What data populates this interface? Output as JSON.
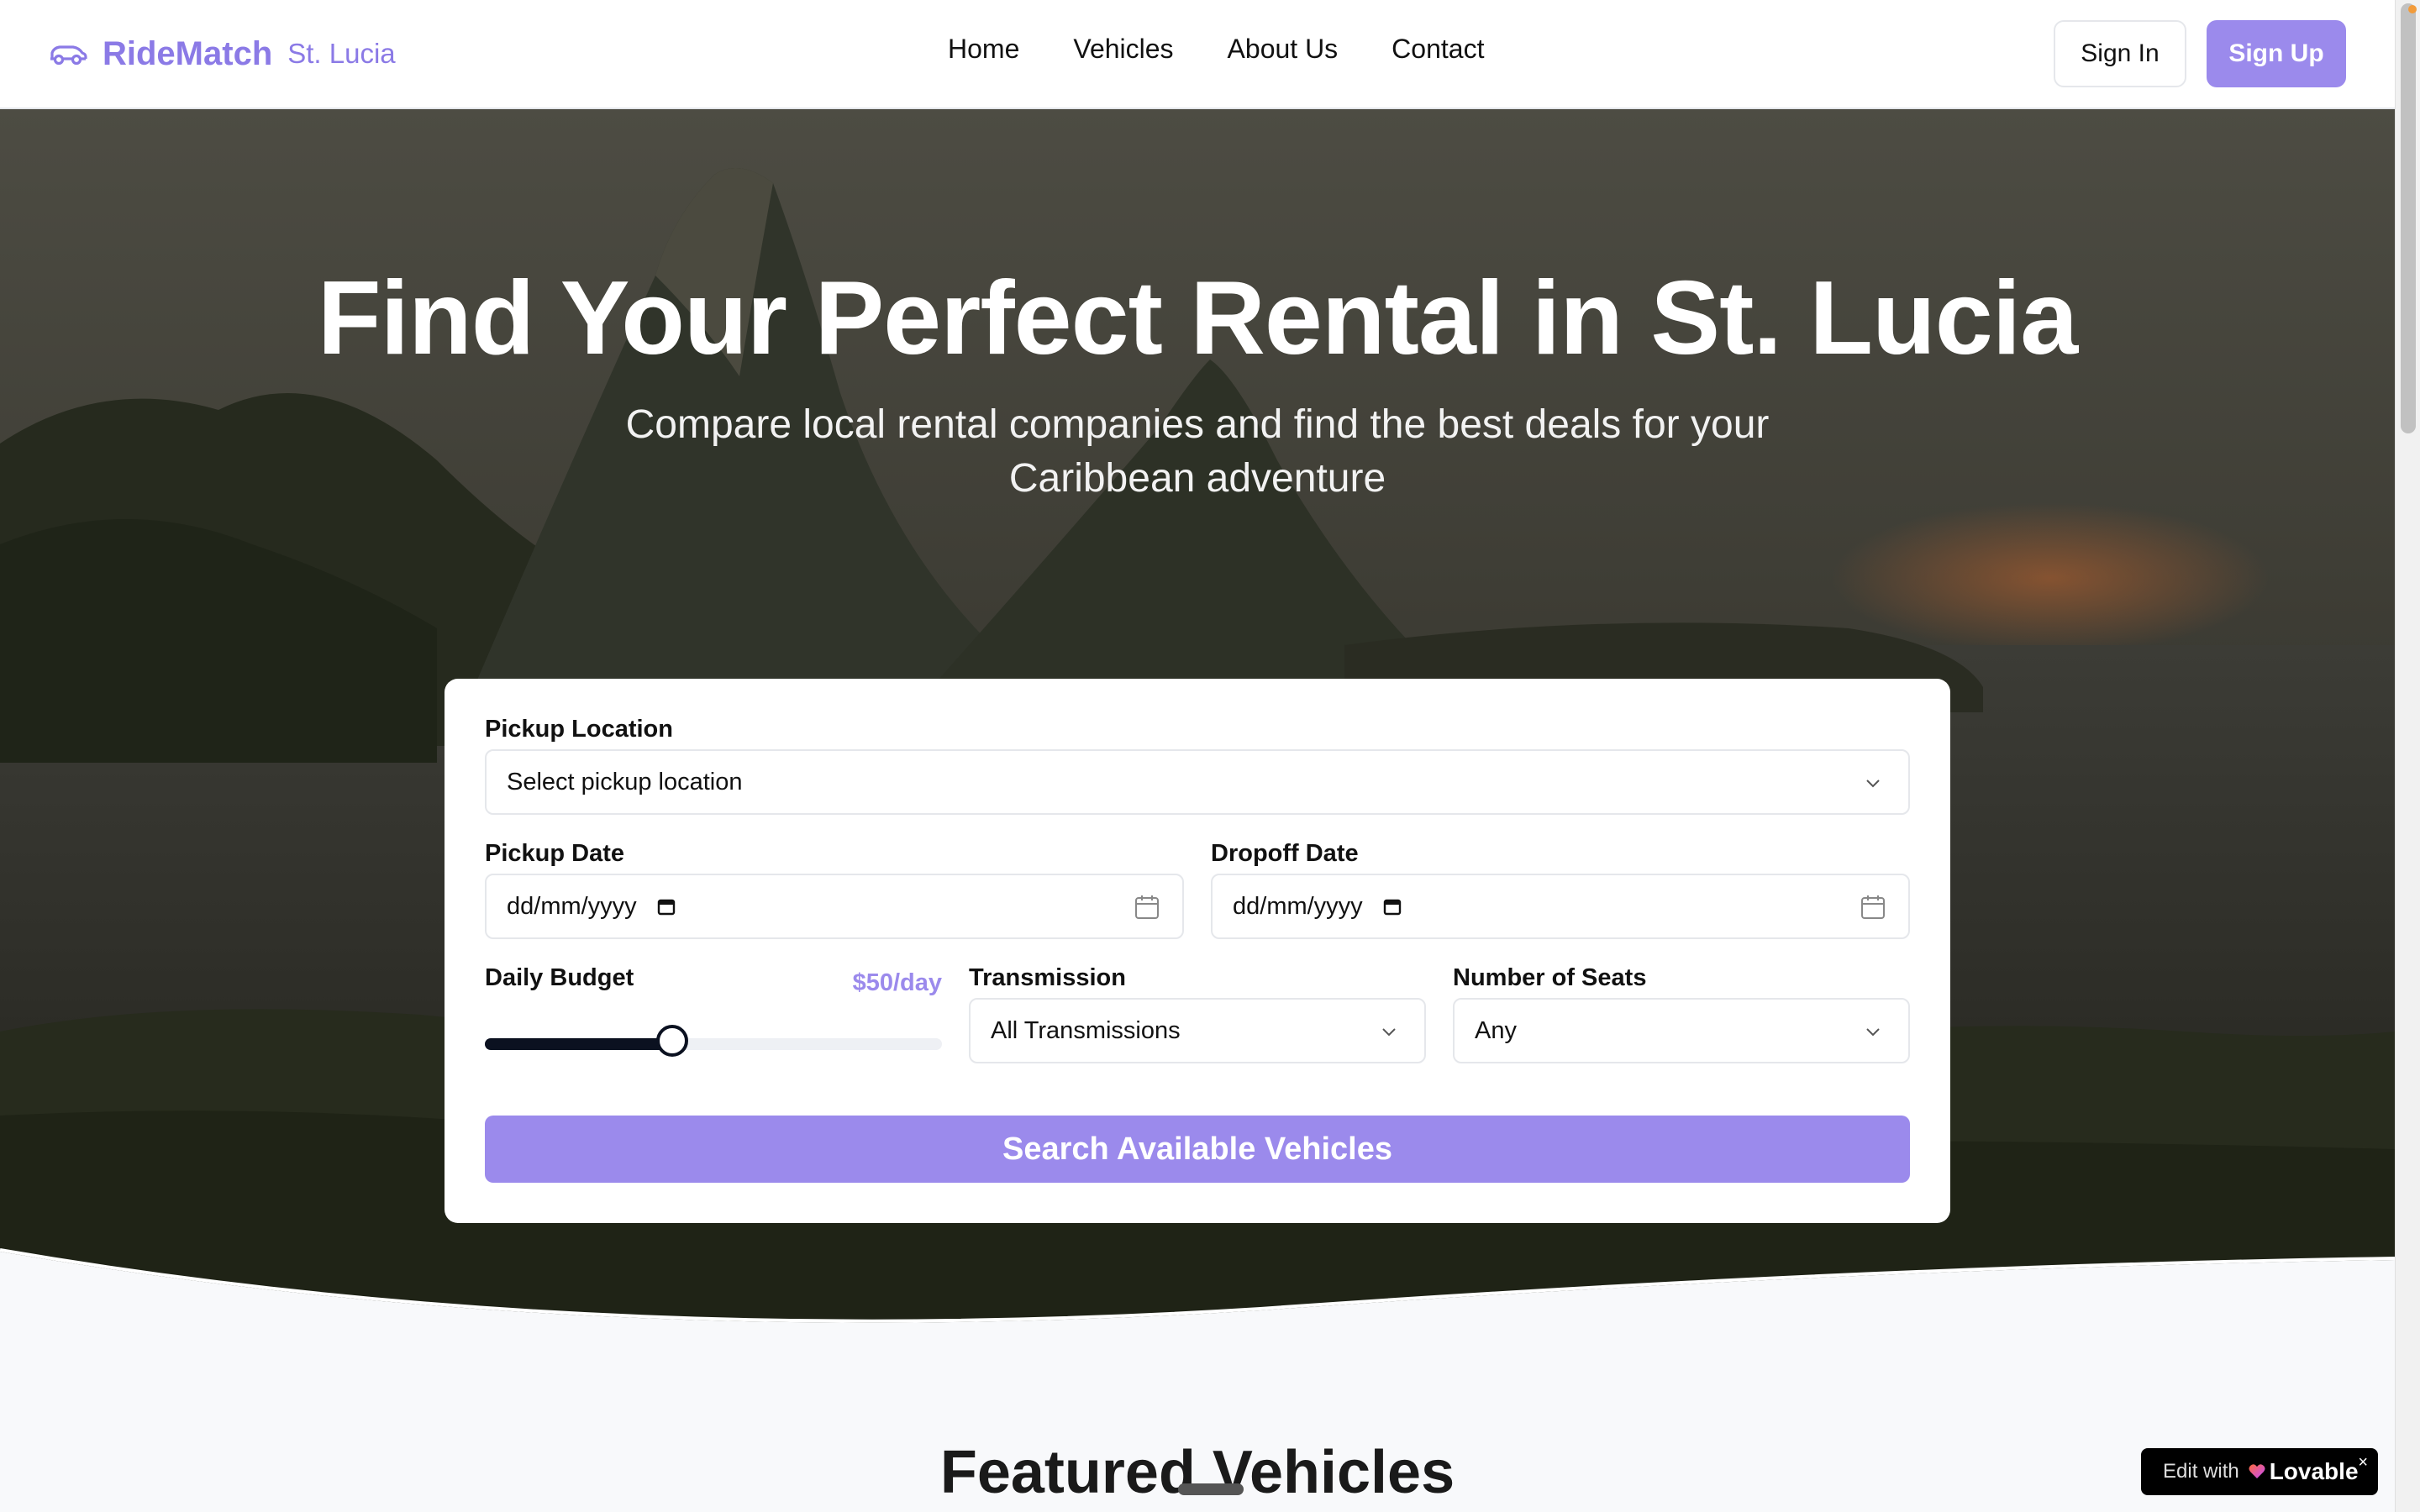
{
  "header": {
    "brand_name": "RideMatch",
    "brand_location": "St. Lucia",
    "nav": [
      "Home",
      "Vehicles",
      "About Us",
      "Contact"
    ],
    "sign_in": "Sign In",
    "sign_up": "Sign Up"
  },
  "hero": {
    "title": "Find Your Perfect Rental in St. Lucia",
    "subtitle": "Compare local rental companies and find the best deals for your Caribbean adventure"
  },
  "search": {
    "pickup_location_label": "Pickup Location",
    "pickup_location_value": "Select pickup location",
    "pickup_date_label": "Pickup Date",
    "pickup_date_value": "dd/mm/yyyy",
    "dropoff_date_label": "Dropoff Date",
    "dropoff_date_value": "dd/mm/yyyy",
    "budget_label": "Daily Budget",
    "budget_value": "$50/day",
    "budget_slider_fraction": 0.41,
    "transmission_label": "Transmission",
    "transmission_value": "All Transmissions",
    "seats_label": "Number of Seats",
    "seats_value": "Any",
    "button": "Search Available Vehicles"
  },
  "featured": {
    "title": "Featured Vehicles"
  },
  "badge": {
    "prefix": "Edit with",
    "brand": "Lovable",
    "close": "×"
  },
  "colors": {
    "accent": "#9b8aec",
    "slider": "#0b1120"
  },
  "icons": [
    "car-icon",
    "chevron-down-icon",
    "calendar-icon",
    "heart-icon",
    "close-icon"
  ]
}
